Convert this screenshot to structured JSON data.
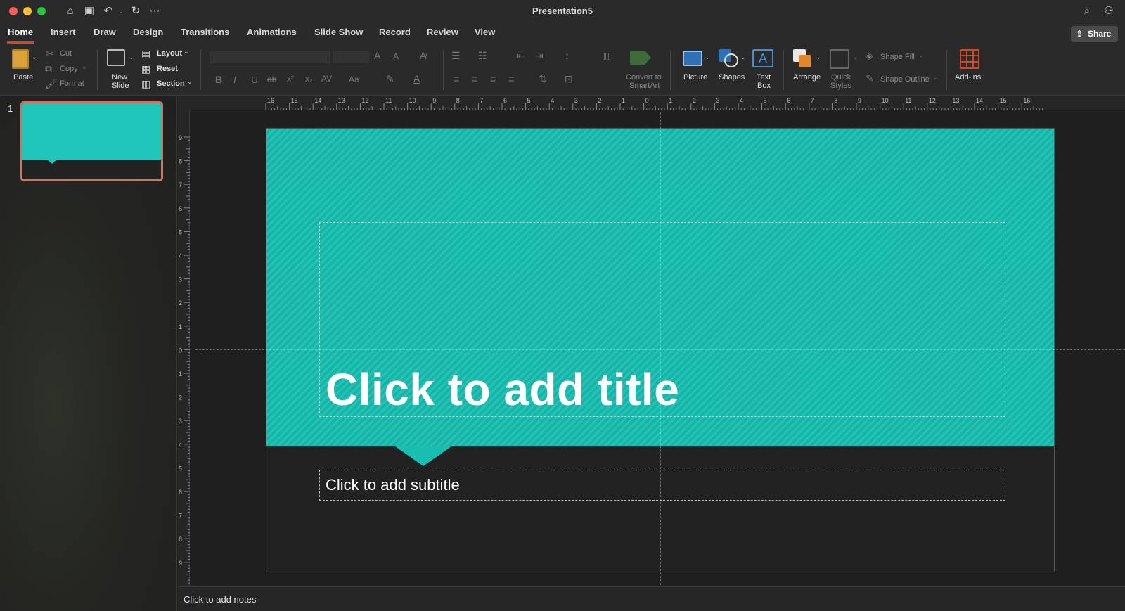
{
  "window": {
    "title": "Presentation5",
    "traffic_colors": [
      "#ff5f57",
      "#febc2e",
      "#28c840"
    ]
  },
  "titlebar_icons": [
    "home-icon",
    "save-icon",
    "undo-icon",
    "redo-icon",
    "more-icon",
    "search-icon",
    "collaborate-icon"
  ],
  "tabs": [
    {
      "label": "Home",
      "active": true
    },
    {
      "label": "Insert"
    },
    {
      "label": "Draw"
    },
    {
      "label": "Design"
    },
    {
      "label": "Transitions"
    },
    {
      "label": "Animations"
    },
    {
      "label": "Slide Show"
    },
    {
      "label": "Record"
    },
    {
      "label": "Review"
    },
    {
      "label": "View"
    }
  ],
  "share_label": "Share",
  "ribbon": {
    "paste": "Paste",
    "cut": "Cut",
    "copy": "Copy",
    "format": "Format",
    "new_slide_line1": "New",
    "new_slide_line2": "Slide",
    "layout": "Layout",
    "reset": "Reset",
    "section": "Section",
    "convert_line1": "Convert to",
    "convert_line2": "SmartArt",
    "picture": "Picture",
    "shapes": "Shapes",
    "text_box_line1": "Text",
    "text_box_line2": "Box",
    "arrange": "Arrange",
    "quick_styles_line1": "Quick",
    "quick_styles_line2": "Styles",
    "shape_fill": "Shape Fill",
    "shape_outline": "Shape Outline",
    "add_ins": "Add-ins",
    "font_btns": [
      "B",
      "I",
      "U",
      "ab",
      "x²",
      "x₂",
      "AV",
      "Aa"
    ]
  },
  "slides_panel": {
    "slide_number": "1"
  },
  "slide": {
    "title_placeholder": "Click to add title",
    "subtitle_placeholder": "Click to add subtitle",
    "accent_color": "#17bfb1",
    "bottom_color": "#222222"
  },
  "notes_placeholder": "Click to add notes",
  "rulers": {
    "horizontal": [
      "16",
      "15",
      "14",
      "13",
      "12",
      "11",
      "10",
      "9",
      "8",
      "7",
      "6",
      "5",
      "4",
      "3",
      "2",
      "1",
      "0",
      "1",
      "2",
      "3",
      "4",
      "5",
      "6",
      "7",
      "8",
      "9",
      "10",
      "11",
      "12",
      "13",
      "14",
      "15",
      "16"
    ],
    "vertical": [
      "9",
      "8",
      "7",
      "6",
      "5",
      "4",
      "3",
      "2",
      "1",
      "0",
      "1",
      "2",
      "3",
      "4",
      "5",
      "6",
      "7",
      "8",
      "9"
    ]
  }
}
